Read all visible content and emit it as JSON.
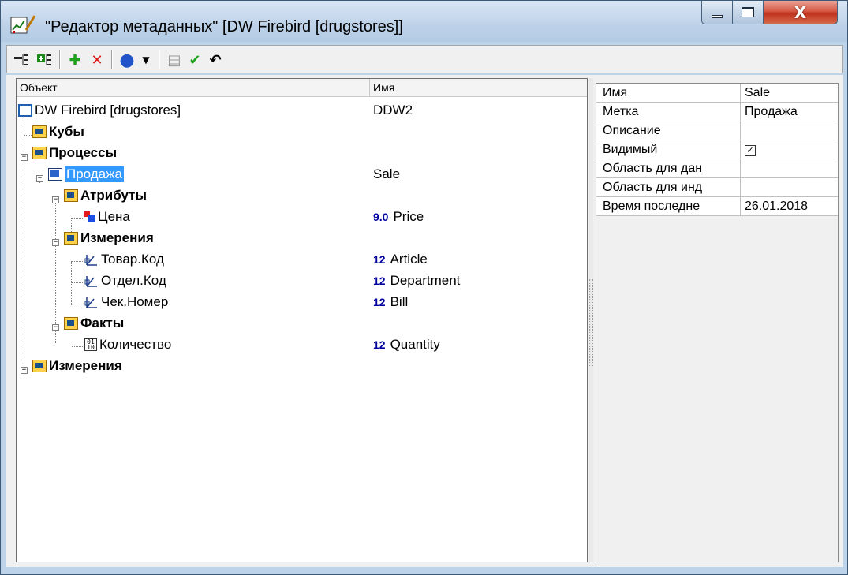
{
  "window": {
    "title": "\"Редактор метаданных\" [DW Firebird [drugstores]]",
    "close_glyph": "X"
  },
  "toolbar": {
    "buttons": [
      {
        "name": "collapse-all-icon"
      },
      {
        "name": "expand-all-icon"
      },
      {
        "name": "add-icon",
        "glyph": "✚",
        "color": "#1fa31f"
      },
      {
        "name": "delete-icon",
        "glyph": "✕",
        "color": "#e01a1a"
      },
      {
        "name": "globe-icon",
        "glyph": "●",
        "color": "#2154c8"
      },
      {
        "name": "dropdown-arrow-icon",
        "glyph": "▼"
      },
      {
        "name": "edit-icon",
        "glyph": "▤",
        "color": "#9a9a9a"
      },
      {
        "name": "apply-icon",
        "glyph": "✔",
        "color": "#1fa31f"
      },
      {
        "name": "undo-icon",
        "glyph": "↶",
        "color": "#000000"
      }
    ]
  },
  "tree": {
    "col_object": "Объект",
    "col_name": "Имя",
    "root": {
      "label": "DW Firebird [drugstores]",
      "value": "DDW2"
    },
    "cubes": {
      "label": "Кубы"
    },
    "processes": {
      "label": "Процессы"
    },
    "sale": {
      "label": "Продажа",
      "value": "Sale"
    },
    "attributes": {
      "label": "Атрибуты"
    },
    "price": {
      "label": "Цена",
      "num": "9.0",
      "value": "Price"
    },
    "measurements": {
      "label": "Измерения"
    },
    "article": {
      "label": "Товар.Код",
      "num": "12",
      "value": "Article"
    },
    "department": {
      "label": "Отдел.Код",
      "num": "12",
      "value": "Department"
    },
    "bill": {
      "label": "Чек.Номер",
      "num": "12",
      "value": "Bill"
    },
    "facts": {
      "label": "Факты"
    },
    "quantity": {
      "label": "Количество",
      "num": "12",
      "value": "Quantity"
    },
    "dimensions": {
      "label": "Измерения"
    }
  },
  "properties": [
    {
      "key": "Имя",
      "value": "Sale"
    },
    {
      "key": "Метка",
      "value": "Продажа"
    },
    {
      "key": "Описание",
      "value": ""
    },
    {
      "key": "Видимый",
      "value": "",
      "checked": true
    },
    {
      "key": "Область для дан",
      "value": ""
    },
    {
      "key": "Область для инд",
      "value": ""
    },
    {
      "key": "Время последне",
      "value": "26.01.2018"
    }
  ],
  "colors": {
    "selection": "#3399ff",
    "number": "#0000a0",
    "titlebar": "#bcd3ea"
  }
}
